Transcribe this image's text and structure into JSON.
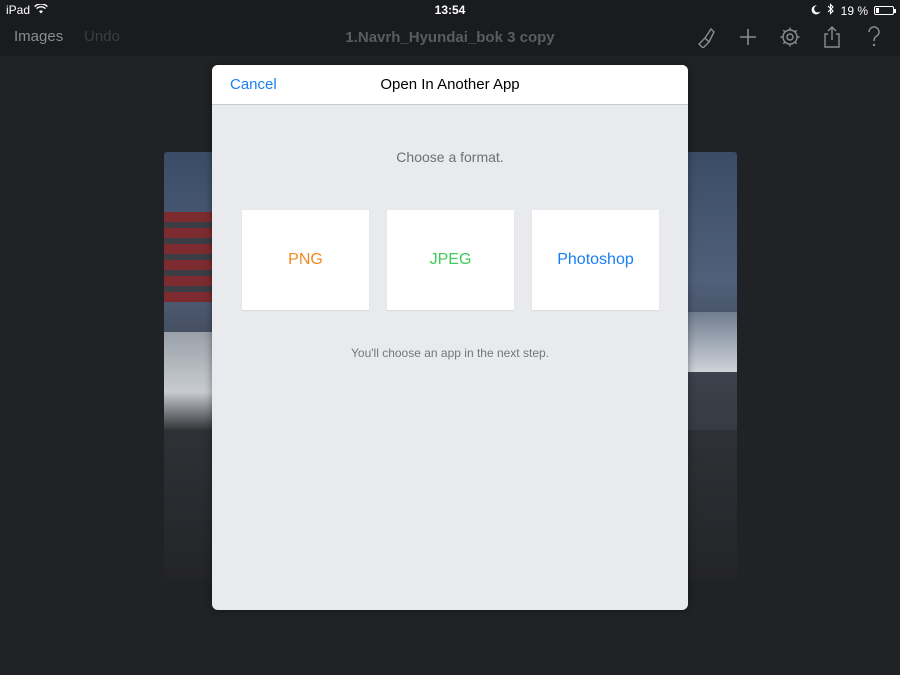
{
  "status_bar": {
    "device": "iPad",
    "time": "13:54",
    "battery_text": "19 %",
    "battery_level": 0.19
  },
  "toolbar": {
    "images_label": "Images",
    "undo_label": "Undo",
    "document_title": "1.Navrh_Hyundai_bok 3 copy",
    "icons": [
      "brush-icon",
      "plus-icon",
      "gear-icon",
      "share-icon",
      "help-icon"
    ]
  },
  "modal": {
    "cancel_label": "Cancel",
    "title": "Open In Another App",
    "prompt": "Choose a format.",
    "formats": [
      {
        "label": "PNG",
        "color": "#f08a24"
      },
      {
        "label": "JPEG",
        "color": "#3ecb5a"
      },
      {
        "label": "Photoshop",
        "color": "#1a7ff0"
      }
    ],
    "note": "You'll choose an app in the next step."
  },
  "colors": {
    "accent": "#1a7ff0",
    "background": "#202226",
    "modal_bg": "#e9eaed"
  }
}
